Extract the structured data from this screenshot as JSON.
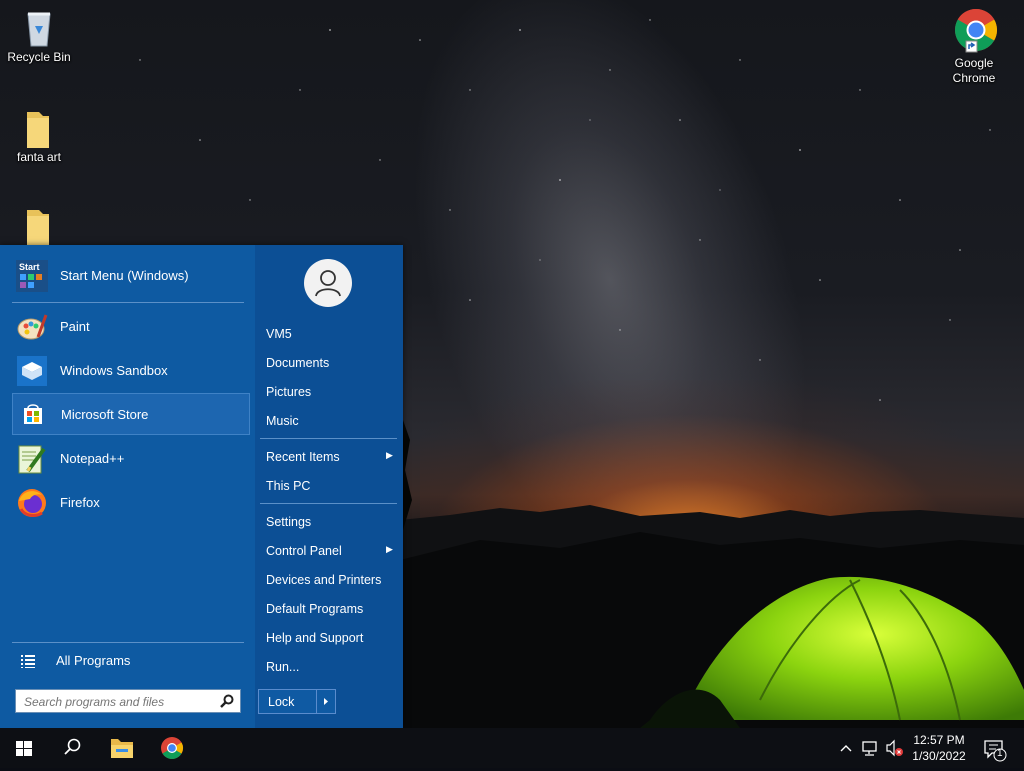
{
  "desktop": {
    "icons": [
      {
        "label": "Recycle Bin",
        "icon": "recycle-bin-icon"
      },
      {
        "label": "fanta art",
        "icon": "folder-icon"
      },
      {
        "label": "",
        "icon": "folder-icon"
      },
      {
        "label": "Google Chrome",
        "icon": "chrome-icon"
      }
    ]
  },
  "start_menu": {
    "pinned": [
      {
        "label": "Start Menu (Windows)",
        "icon": "start-menu-icon"
      },
      {
        "label": "Paint",
        "icon": "paint-icon"
      },
      {
        "label": "Windows Sandbox",
        "icon": "sandbox-icon"
      },
      {
        "label": "Microsoft Store",
        "icon": "store-icon"
      },
      {
        "label": "Notepad++",
        "icon": "notepadpp-icon"
      },
      {
        "label": "Firefox",
        "icon": "firefox-icon"
      }
    ],
    "all_programs": "All Programs",
    "search_placeholder": "Search programs and files",
    "user_icon": "user-avatar-icon",
    "right_links": [
      {
        "label": "VM5"
      },
      {
        "label": "Documents"
      },
      {
        "label": "Pictures"
      },
      {
        "label": "Music"
      },
      {
        "label": "Recent Items",
        "submenu": true
      },
      {
        "label": "This PC"
      },
      {
        "label": "Settings"
      },
      {
        "label": "Control Panel",
        "submenu": true
      },
      {
        "label": "Devices and Printers"
      },
      {
        "label": "Default Programs"
      },
      {
        "label": "Help and Support"
      },
      {
        "label": "Run..."
      }
    ],
    "lock_label": "Lock",
    "start_tile_text": "Start"
  },
  "taskbar": {
    "buttons": [
      "windows-start-icon",
      "search-icon",
      "file-explorer-icon",
      "chrome-icon"
    ],
    "tray_icons": [
      "chevron-up-icon",
      "network-icon",
      "volume-muted-icon"
    ],
    "time": "12:57 PM",
    "date": "1/30/2022",
    "notification_count": "1"
  },
  "colors": {
    "start_menu_bg": "#0f5aa3",
    "taskbar_bg": "#0d0f14"
  }
}
